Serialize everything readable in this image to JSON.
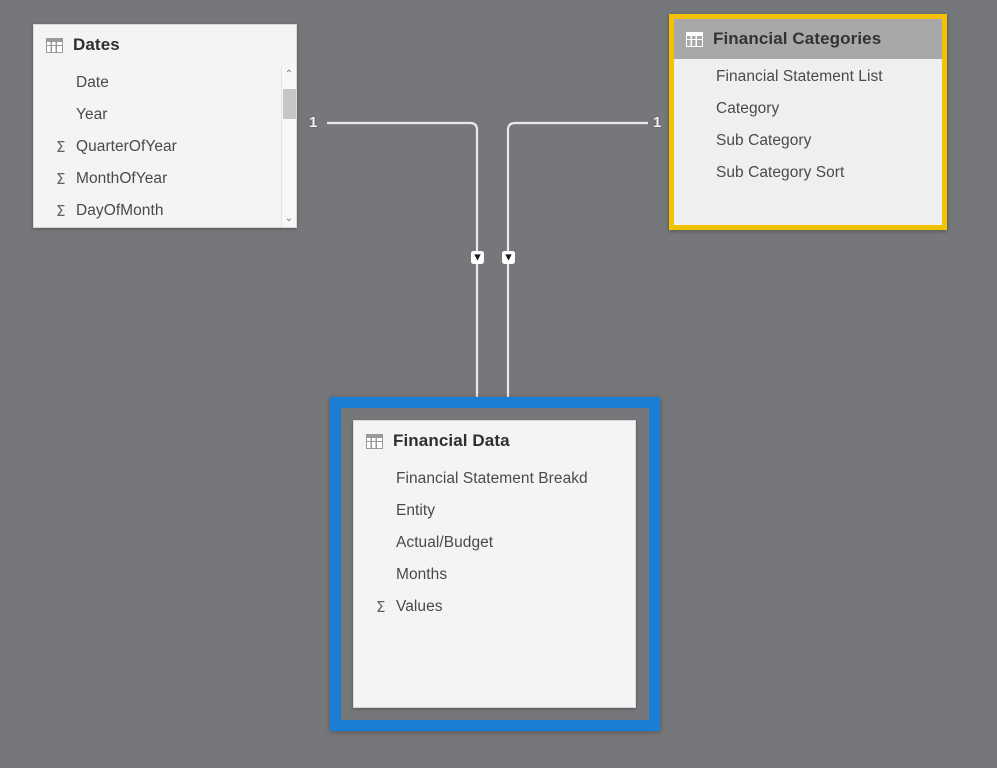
{
  "view": {
    "name": "model-view-canvas",
    "background_color": "#76777a"
  },
  "tables": [
    {
      "id": "dates",
      "title": "Dates",
      "icon": "table-grid-icon",
      "selected": false,
      "highlight": "none",
      "header_style": "plain",
      "has_scrollbar": true,
      "fields": [
        {
          "name": "Date",
          "aggregate": false
        },
        {
          "name": "Year",
          "aggregate": false
        },
        {
          "name": "QuarterOfYear",
          "aggregate": true
        },
        {
          "name": "MonthOfYear",
          "aggregate": true
        },
        {
          "name": "DayOfMonth",
          "aggregate": true
        }
      ]
    },
    {
      "id": "financial-categories",
      "title": "Financial Categories",
      "icon": "table-grid-icon",
      "selected": false,
      "highlight": "yellow",
      "highlight_color": "#f2c200",
      "header_style": "grayband",
      "has_scrollbar": false,
      "fields": [
        {
          "name": "Financial Statement List",
          "aggregate": false
        },
        {
          "name": "Category",
          "aggregate": false
        },
        {
          "name": "Sub Category",
          "aggregate": false
        },
        {
          "name": "Sub Category Sort",
          "aggregate": false
        }
      ]
    },
    {
      "id": "financial-data",
      "title": "Financial Data",
      "icon": "table-grid-icon",
      "selected": true,
      "highlight": "blue",
      "highlight_color": "#1a7fd4",
      "header_style": "plain",
      "has_scrollbar": false,
      "fields": [
        {
          "name": "Financial Statement Breakd",
          "aggregate": false
        },
        {
          "name": "Entity",
          "aggregate": false
        },
        {
          "name": "Actual/Budget",
          "aggregate": false
        },
        {
          "name": "Months",
          "aggregate": false
        },
        {
          "name": "Values",
          "aggregate": true
        }
      ]
    }
  ],
  "relationships": [
    {
      "id": "dates-to-financial-data",
      "from_table": "Dates",
      "to_table": "Financial Data",
      "from_cardinality": "1",
      "to_cardinality": "",
      "cross_filter_direction": "single",
      "arrow": "down"
    },
    {
      "id": "financial-categories-to-financial-data",
      "from_table": "Financial Categories",
      "to_table": "Financial Data",
      "from_cardinality": "1",
      "to_cardinality": "",
      "cross_filter_direction": "single",
      "arrow": "down"
    }
  ],
  "scrollbar": {
    "up_arrow": "⌃",
    "down_arrow": "⌄"
  },
  "glyphs": {
    "sigma": "Σ"
  }
}
